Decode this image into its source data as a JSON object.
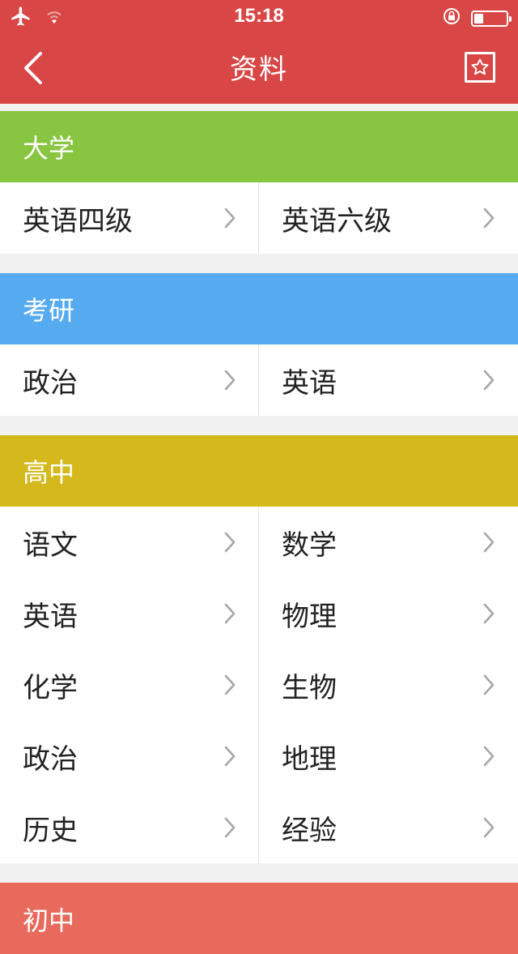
{
  "status_bar": {
    "time": "15:18",
    "left_icons": [
      "airplane-icon",
      "wifi-icon"
    ],
    "right_icons": [
      "rotation-lock-icon",
      "battery-icon"
    ],
    "battery_level": 0.3
  },
  "nav": {
    "title": "资料",
    "back_icon": "chevron-left-icon",
    "favorite_icon": "star-icon"
  },
  "colors": {
    "header": "#d84646",
    "university": "#88c541",
    "postgrad": "#56aaf0",
    "highschool": "#d5b91c",
    "middleschool": "#e86a5c"
  },
  "sections": [
    {
      "title": "大学",
      "items": [
        "英语四级",
        "英语六级"
      ]
    },
    {
      "title": "考研",
      "items": [
        "政治",
        "英语"
      ]
    },
    {
      "title": "高中",
      "items": [
        "语文",
        "数学",
        "英语",
        "物理",
        "化学",
        "生物",
        "政治",
        "地理",
        "历史",
        "经验"
      ]
    },
    {
      "title": "初中",
      "items": []
    }
  ]
}
